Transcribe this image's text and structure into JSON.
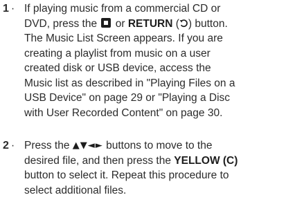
{
  "steps": [
    {
      "number": "1",
      "separator": "·",
      "lines": {
        "l1": "If playing music from a commercial CD or",
        "l2_a": "DVD, press the",
        "l2_or": "or",
        "l2_return": "RETURN",
        "l2_paren_open": "(",
        "l2_paren_close": ") button.",
        "l3": "The Music List Screen appears. If you are",
        "l4": "creating a playlist from music on a user",
        "l5": "created disk or USB device, access the",
        "l6": "Music list as described in \"Playing Files on a",
        "l7": "USB Device\" on page 29 or \"Playing a Disc",
        "l8": "with User Recorded Content\" on page 30."
      },
      "icons": [
        "stop-icon",
        "return-icon"
      ]
    },
    {
      "number": "2",
      "separator": "·",
      "lines": {
        "l1_a": "Press the",
        "l1_arrows": "▲▼◄►",
        "l1_b": "buttons to move to the",
        "l2_a": "desired file, and then press the",
        "l2_yellow": "YELLOW (C)",
        "l3": "button to select it. Repeat this procedure to",
        "l4": "select additional files."
      }
    }
  ]
}
